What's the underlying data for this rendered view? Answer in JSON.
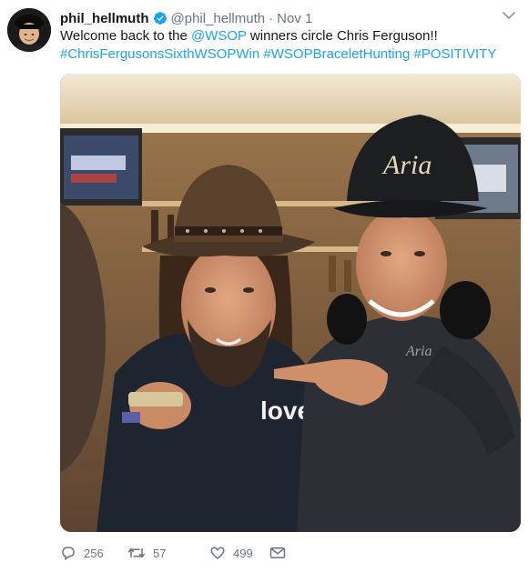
{
  "tweet": {
    "display_name": "phil_hellmuth",
    "handle": "@phil_hellmuth",
    "separator": "·",
    "timestamp": "Nov 1",
    "text_parts": {
      "p1": "Welcome back to the ",
      "mention": "@WSOP",
      "p2": " winners circle Chris Ferguson!!",
      "tag1": "#ChrisFergusonsSixthWSOPWin",
      "tag2": "#WSOPBraceletHunting",
      "tag3": "#POSITIVITY"
    },
    "photo": {
      "left_hat_text": "Aria",
      "right_shirt_text": "Aria",
      "left_shirt_text": "love."
    }
  },
  "actions": {
    "replies": "256",
    "retweets": "57",
    "likes": "499"
  },
  "colors": {
    "link": "#1da1f2",
    "verified": "#1da1f2",
    "muted": "#657786"
  },
  "icons": [
    "verified-badge-icon",
    "chevron-down-icon",
    "reply-icon",
    "retweet-icon",
    "like-icon",
    "dm-icon"
  ]
}
